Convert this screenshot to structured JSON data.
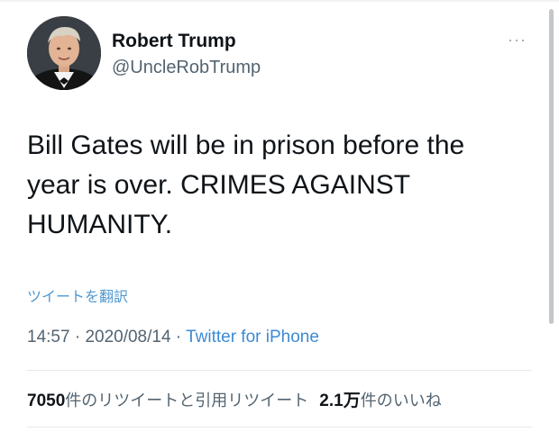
{
  "user": {
    "display_name": "Robert Trump",
    "handle": "@UncleRobTrump",
    "avatar_icon": "profile-photo"
  },
  "more_label": "···",
  "tweet": {
    "lines": [
      "Bill Gates will be in prison before the",
      "year is over. CRIMES AGAINST",
      "HUMANITY."
    ],
    "translate_label": "ツイートを翻訳",
    "time": "14:57",
    "separator1": " · ",
    "date": "2020/08/14",
    "separator2": " · ",
    "source": "Twitter for iPhone"
  },
  "stats": {
    "retweet_count": "7050",
    "retweet_label": "件のリツイートと引用リツイート",
    "like_count": "2.1万",
    "like_label": "件のいいね"
  },
  "colors": {
    "link": "#3d8ad2",
    "muted": "#536471",
    "text": "#0f1419"
  }
}
